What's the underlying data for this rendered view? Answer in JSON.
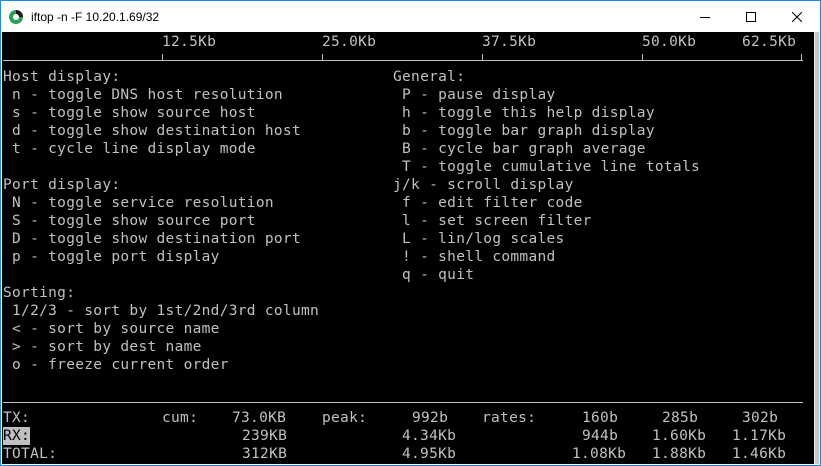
{
  "window": {
    "title": "iftop -n -F 10.20.1.69/32"
  },
  "scale": {
    "labels": [
      "12.5Kb",
      "25.0Kb",
      "37.5Kb",
      "50.0Kb",
      "62.5Kb"
    ]
  },
  "help": {
    "host_display": {
      "heading": "Host display:",
      "items": [
        " n - toggle DNS host resolution",
        " s - toggle show source host",
        " d - toggle show destination host",
        " t - cycle line display mode"
      ]
    },
    "port_display": {
      "heading": "Port display:",
      "items": [
        " N - toggle service resolution",
        " S - toggle show source port",
        " D - toggle show destination port",
        " p - toggle port display"
      ]
    },
    "sorting": {
      "heading": "Sorting:",
      "items": [
        " 1/2/3 - sort by 1st/2nd/3rd column",
        " < - sort by source name",
        " > - sort by dest name",
        " o - freeze current order"
      ]
    },
    "general": {
      "heading": "General:",
      "items": [
        " P - pause display",
        " h - toggle this help display",
        " b - toggle bar graph display",
        " B - cycle bar graph average",
        " T - toggle cumulative line totals",
        "j/k - scroll display",
        " f - edit filter code",
        " l - set screen filter",
        " L - lin/log scales",
        " ! - shell command",
        " q - quit"
      ]
    }
  },
  "stats": {
    "cum_label": "cum:",
    "peak_label": "peak:",
    "rates_label": "rates:",
    "rows": [
      {
        "label": "TX:",
        "cum": "73.0KB",
        "peak": "992b",
        "r1": "160b",
        "r2": "285b",
        "r3": "302b"
      },
      {
        "label": "RX:",
        "cum": "239KB",
        "peak": "4.34Kb",
        "r1": "944b",
        "r2": "1.60Kb",
        "r3": "1.17Kb"
      },
      {
        "label": "TOTAL:",
        "cum": "312KB",
        "peak": "4.95Kb",
        "r1": "1.08Kb",
        "r2": "1.88Kb",
        "r3": "1.46Kb"
      }
    ]
  },
  "colors": {
    "terminal_bg": "#000000",
    "terminal_fg": "#c0c0c0",
    "window_border": "#1e88e5"
  }
}
